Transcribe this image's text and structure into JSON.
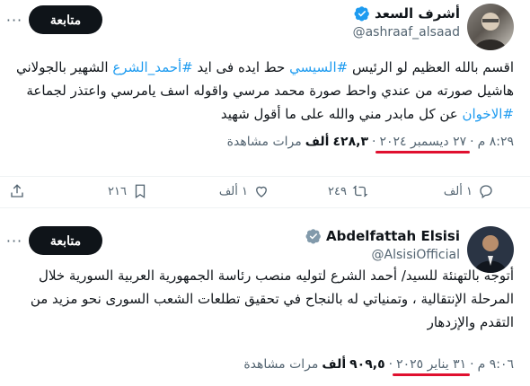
{
  "tweet1": {
    "display_name": "أشرف السعد",
    "handle": "@ashraaf_alsaad",
    "follow_label": "متابعة",
    "more_label": "···",
    "text_part1": "اقسم بالله العظيم لو الرئيس ",
    "hashtag1": "#السيسي",
    "text_part2": " حط ايده فى ايد ",
    "hashtag2": "#أحمد_الشرع",
    "text_part3": " الشهير بالجولاني هاشيل صورته من عندي واحط صورة محمد مرسي واقوله اسف يامرسي واعتذر لجماعة ",
    "hashtag3": "#الاخوان",
    "text_part4": " عن كل مابدر مني والله على ما أقول شهيد",
    "time": "٨:٢٩ م",
    "date": "٢٧ ديسمبر ٢٠٢٤",
    "views_count": "٤٢٨,٣",
    "views_unit": "ألف",
    "views_label": "مرات مشاهدة",
    "replies": "١ ألف",
    "retweets": "٢٤٩",
    "likes": "١ ألف",
    "bookmarks": "٢١٦"
  },
  "tweet2": {
    "display_name": "Abdelfattah Elsisi",
    "handle": "@AlsisiOfficial",
    "follow_label": "متابعة",
    "more_label": "···",
    "text": "أتوجه بالتهنئة للسيد/ أحمد الشرع لتوليه منصب رئاسة الجمهورية العربية السورية خلال المرحلة الإنتقالية ، وتمنياتي له بالنجاح في تحقيق تطلعات الشعب السورى نحو مزيد من التقدم والإزدهار",
    "time": "٩:٠٦ م",
    "date": "٣١ يناير ٢٠٢٥",
    "views_count": "٩٠٩,٥",
    "views_unit": "ألف",
    "views_label": "مرات مشاهدة"
  },
  "colors": {
    "hashtag": "#1d9bf0",
    "verified": "#1d9bf0",
    "verified_gov": "#829aab",
    "highlight_underline": "#e0102f",
    "follow_bg": "#0f1419"
  },
  "icons": {
    "reply": "reply-icon",
    "retweet": "retweet-icon",
    "like": "heart-icon",
    "bookmark": "bookmark-icon",
    "share": "share-icon"
  }
}
